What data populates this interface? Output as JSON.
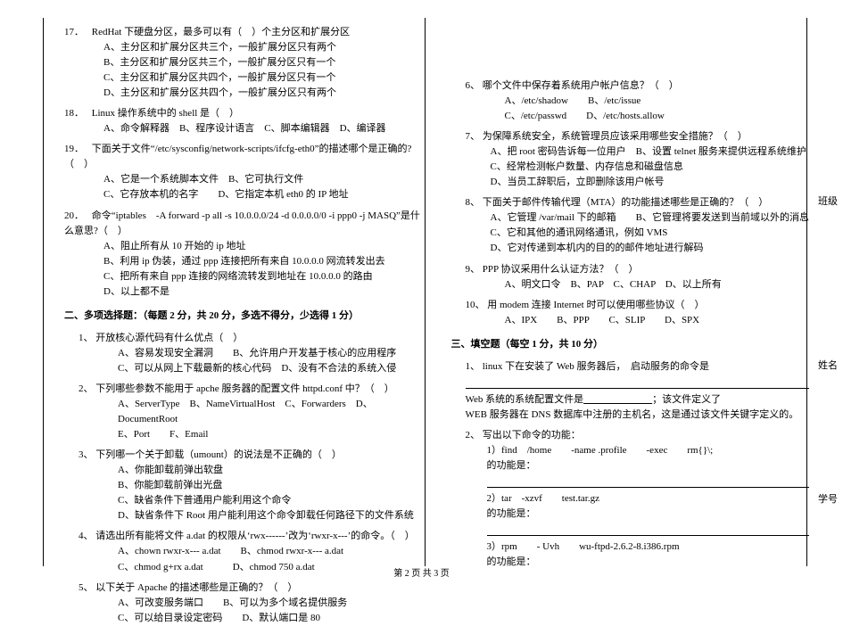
{
  "left": {
    "q17": {
      "num": "17．",
      "stem": "RedHat 下硬盘分区，最多可以有（　）个主分区和扩展分区",
      "a": "A、主分区和扩展分区共三个，一般扩展分区只有两个",
      "b": "B、主分区和扩展分区共三个，一般扩展分区只有一个",
      "c": "C、主分区和扩展分区共四个，一般扩展分区只有一个",
      "d": "D、主分区和扩展分区共四个，一般扩展分区只有两个"
    },
    "q18": {
      "num": "18．",
      "stem": "Linux 操作系统中的 shell 是（　）",
      "opts": "A、命令解释器　B、程序设计语言　C、脚本编辑器　D、编译器"
    },
    "q19": {
      "num": "19．",
      "stem": "下面关于文件“/etc/sysconfig/network-scripts/ifcfg-eth0”的描述哪个是正确的?（　）",
      "a": "A、它是一个系统脚本文件　B、它可执行文件",
      "c": "C、它存放本机的名字　　D、它指定本机 eth0 的 IP 地址"
    },
    "q20": {
      "num": "20．",
      "stem": "命令“iptables　-A forward -p all -s 10.0.0.0/24 -d 0.0.0.0/0 -i ppp0 -j MASQ”是什么意思?（　）",
      "a": "A、阻止所有从 10 开始的 ip 地址",
      "b": "B、利用 ip 伪装，通过 ppp 连接把所有来自 10.0.0.0 网流转发出去",
      "c": "C、把所有来自 ppp 连接的网络流转发到地址在 10.0.0.0 的路由",
      "d": "D、以上都不是"
    },
    "sec2": "二、多项选择题：（每题 2 分，共 20 分，多选不得分，少选得 1 分）",
    "m1": {
      "num": "1、",
      "stem": "开放核心源代码有什么优点（　）",
      "a": "A、容易发现安全漏洞　　B、允许用户开发基于核心的应用程序",
      "c": "C、可以从网上下载最新的核心代码　D、没有不合法的系统入侵"
    },
    "m2": {
      "num": "2、",
      "stem": "下列哪些参数不能用于 apche 服务器的配置文件 httpd.conf 中？（　）",
      "a": "A、ServerType　B、NameVirtualHost　C、Forwarders　D、DocumentRoot",
      "e": "E、Port　　F、Email"
    },
    "m3": {
      "num": "3、",
      "stem": "下列哪一个关于卸载（umount）的说法是不正确的（　）",
      "a": "A、你能卸载前弹出软盘",
      "b": "B、你能卸载前弹出光盘",
      "c": "C、缺省条件下普通用户能利用这个命令",
      "d": "D、缺省条件下 Root 用户能利用这个命令卸载任何路径下的文件系统"
    },
    "m4": {
      "num": "4、",
      "stem": "请选出所有能将文件 a.dat 的权限从‘rwx------’改为‘rwxr-x---’的命令。（　）",
      "a": "A、chown  rwxr-x---  a.dat　　B、chmod  rwxr-x---  a.dat",
      "c": "C、chmod  g+rx  a.dat　　　D、chmod  750  a.dat"
    },
    "m5": {
      "num": "5、",
      "stem": "以下关于 Apache 的描述哪些是正确的？（　）",
      "a": "A、可改变服务端口　　B、可以为多个域名提供服务",
      "c": "C、可以给目录设定密码　　D、默认端口是 80"
    }
  },
  "right": {
    "m6": {
      "num": "6、",
      "stem": "哪个文件中保存着系统用户帐户信息？（　）",
      "a": "A、/etc/shadow　　B、/etc/issue",
      "c": "C、/etc/passwd　　D、/etc/hosts.allow"
    },
    "m7": {
      "num": "7、",
      "stem": "为保障系统安全，系统管理员应该采用哪些安全措施？（　）",
      "a": "A、把 root 密码告诉每一位用户　B、设置 telnet 服务来提供远程系统维护",
      "c": "C、经常检测帐户数量、内存信息和磁盘信息",
      "d": "D、当员工辞职后，立即删除该用户帐号"
    },
    "m8": {
      "num": "8、",
      "stem": "下面关于邮件传输代理（MTA）的功能描述哪些是正确的？（　）",
      "a": "A、它管理 /var/mail 下的邮箱　　B、它管理将要发送到当前域以外的消息",
      "c": "C、它和其他的通讯网络通讯，例如 VMS",
      "d": "D、它对传递到本机内的目的的邮件地址进行解码"
    },
    "m9": {
      "num": "9、",
      "stem": "PPP 协议采用什么认证方法？（　）",
      "opts": "A、明文口令　B、PAP　C、CHAP　D、以上所有"
    },
    "m10": {
      "num": "10、",
      "stem": "用 modem 连接 Internet 时可以使用哪些协议（　）",
      "opts": "A、IPX　　B、PPP　　C、SLIP　　D、SPX"
    },
    "sec3": "三、填空题（每空 1 分，共 10 分）",
    "f1": {
      "num": "1、",
      "l1": "linux 下在安装了 Web 服务器后，　启动服务的命令是",
      "l2_pre": "Web 系统的系统配置文件是",
      "l2_suf": "；该文件定义了",
      "l3": "WEB 服务器在 DNS 数据库中注册的主机名，这是通过该文件关键字定义的。"
    },
    "f2": {
      "num": "2、",
      "stem": "写出以下命令的功能：",
      "c1": "1）find　/home　　-name  .profile　　-exec　　rm{}\\;",
      "c2": "2）tar　-xzvf　　test.tar.gz",
      "c3": "3）rpm　　- Uvh　　wu-ftpd-2.6.2-8.i386.rpm",
      "lab": "的功能是："
    }
  },
  "side": {
    "s1": "班级",
    "s2": "姓名",
    "s3": "学号"
  },
  "footer": "第 2 页 共 3 页"
}
